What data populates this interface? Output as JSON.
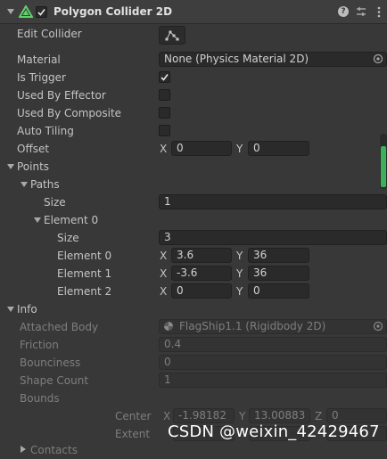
{
  "header": {
    "title": "Polygon Collider 2D",
    "enabled": true,
    "icons": [
      "help-icon",
      "presets-icon",
      "kebab-menu-icon"
    ]
  },
  "rows": {
    "edit_collider": {
      "label": "Edit Collider"
    },
    "material": {
      "label": "Material",
      "value": "None (Physics Material 2D)"
    },
    "is_trigger": {
      "label": "Is Trigger",
      "checked": true
    },
    "used_by_effector": {
      "label": "Used By Effector",
      "checked": false
    },
    "used_by_composite": {
      "label": "Used By Composite",
      "checked": false
    },
    "auto_tiling": {
      "label": "Auto Tiling",
      "checked": false
    },
    "offset": {
      "label": "Offset",
      "x_label": "X",
      "x": "0",
      "y_label": "Y",
      "y": "0"
    }
  },
  "points": {
    "label": "Points",
    "paths": {
      "label": "Paths",
      "size_label": "Size",
      "size": "1",
      "element0": {
        "label": "Element 0",
        "size_label": "Size",
        "size": "3",
        "elements": [
          {
            "label": "Element 0",
            "x": "3.6",
            "y": "36"
          },
          {
            "label": "Element 1",
            "x": "-3.6",
            "y": "36"
          },
          {
            "label": "Element 2",
            "x": "0",
            "y": "0"
          }
        ]
      }
    }
  },
  "info": {
    "label": "Info",
    "attached_body": {
      "label": "Attached Body",
      "value": "FlagShip1.1 (Rigidbody 2D)"
    },
    "friction": {
      "label": "Friction",
      "value": "0.4"
    },
    "bounciness": {
      "label": "Bounciness",
      "value": "0"
    },
    "shape_count": {
      "label": "Shape Count",
      "value": "1"
    },
    "bounds": {
      "label": "Bounds",
      "center": {
        "label": "Center",
        "x": "-1.98182",
        "y": "13.00883",
        "z": "0"
      },
      "extent": {
        "label": "Extent"
      }
    },
    "contacts": {
      "label": "Contacts"
    }
  },
  "axis": {
    "x": "X",
    "y": "Y",
    "z": "Z"
  },
  "watermark": "CSDN @weixin_42429467",
  "colors": {
    "background": "#383838",
    "scrollbar_accent": "#3cb05a"
  }
}
